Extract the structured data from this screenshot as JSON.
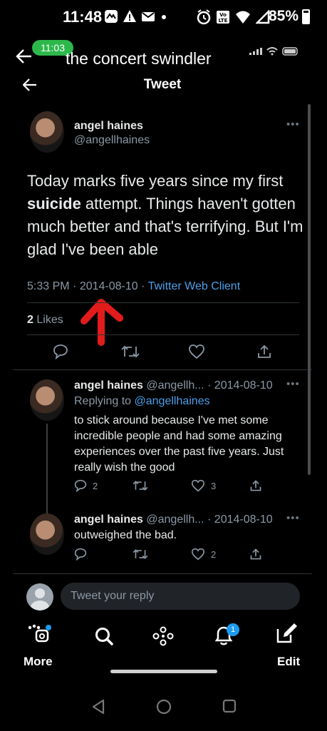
{
  "status_bar": {
    "time": "11:48",
    "battery": "85%"
  },
  "outer_app": {
    "title": "the concert swindler",
    "pill_time": "11:03"
  },
  "twitter": {
    "header_title": "Tweet",
    "main_tweet": {
      "author_name": "angel haines",
      "author_handle": "@angellhaines",
      "text_1": "Today marks five years since my first ",
      "text_bold": "suicide",
      "text_2": " attempt. Things haven't gotten much better and that's terrifying. But I'm glad I've been able",
      "time": "5:33 PM",
      "date": "2014-08-10",
      "client": "Twitter Web Client",
      "likes_count": "2",
      "likes_label": "Likes"
    },
    "replies": [
      {
        "author_name": "angel haines",
        "author_handle": "@angellh...",
        "date": "2014-08-10",
        "replying_label": "Replying to",
        "replying_to": "@angellhaines",
        "text": "to stick around because I've met some incredible people and had some amazing experiences over the past five years. Just really wish the good",
        "reply_count": "2",
        "like_count": "3"
      },
      {
        "author_name": "angel haines",
        "author_handle": "@angellh...",
        "date": "2014-08-10",
        "text": "outweighed the bad.",
        "like_count": "2"
      }
    ],
    "compose_placeholder": "Tweet your reply"
  },
  "bottom_nav": {
    "more_label": "More",
    "edit_label": "Edit",
    "notifications_badge": "1"
  },
  "colors": {
    "accent": "#1d9bf0",
    "link": "#4a9fe9",
    "annotation": "#e21b1b",
    "pill": "#2db84c"
  },
  "icons": [
    "back-arrow-icon",
    "more-dots-icon",
    "reply-icon",
    "retweet-icon",
    "like-icon",
    "share-icon",
    "search-icon",
    "spaces-icon",
    "notifications-icon",
    "edit-icon",
    "android-back-icon",
    "android-home-icon",
    "android-recents-icon"
  ]
}
